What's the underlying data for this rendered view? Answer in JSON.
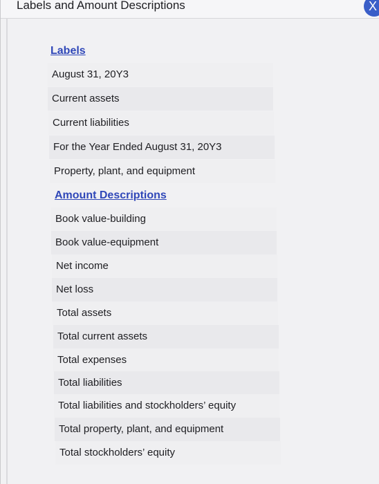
{
  "window": {
    "title": "Labels and Amount Descriptions",
    "close_glyph": "X"
  },
  "labels_section": {
    "heading": "Labels",
    "items": [
      "August 31, 20Y3",
      "Current assets",
      "Current liabilities",
      "For the Year Ended August 31, 20Y3",
      "Property, plant, and equipment"
    ]
  },
  "amounts_section": {
    "heading": "Amount Descriptions",
    "items": [
      "Book value-building",
      "Book value-equipment",
      "Net income",
      "Net loss",
      "Total assets",
      "Total current assets",
      "Total expenses",
      "Total liabilities",
      "Total liabilities and stockholders’ equity",
      "Total property, plant, and equipment",
      "Total stockholders’ equity"
    ]
  },
  "colors": {
    "link": "#2f47b8",
    "close_button": "#3a5ec8"
  }
}
